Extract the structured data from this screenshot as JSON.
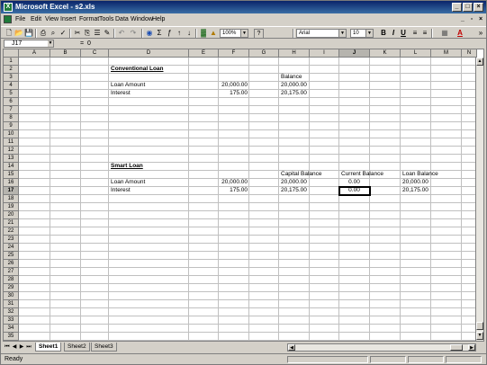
{
  "window": {
    "title": "Microsoft Excel - s2.xls",
    "app_icon_glyph": "X",
    "buttons": [
      "_",
      "□",
      "×"
    ]
  },
  "menu": {
    "items": [
      "File",
      "Edit",
      "View",
      "Insert",
      "Format",
      "Tools",
      "Data",
      "Window",
      "Help"
    ],
    "doc_buttons": [
      "_",
      "▫",
      "×"
    ]
  },
  "toolbar": {
    "zoom": "100%",
    "font": "Arial",
    "size": "10",
    "help": "?"
  },
  "formula_bar": {
    "name_box": "J17",
    "equals": "=",
    "value": "0"
  },
  "columns": [
    "A",
    "B",
    "C",
    "D",
    "E",
    "F",
    "G",
    "H",
    "I",
    "J",
    "K",
    "L",
    "M",
    "N"
  ],
  "active_column": "J",
  "active_row": "17",
  "rows": [
    "1",
    "2",
    "3",
    "4",
    "5",
    "6",
    "7",
    "8",
    "9",
    "10",
    "11",
    "12",
    "13",
    "14",
    "15",
    "16",
    "17",
    "18",
    "19",
    "20",
    "21",
    "22",
    "23",
    "24",
    "25",
    "26",
    "27",
    "28",
    "29",
    "30",
    "31",
    "32",
    "33",
    "34",
    "35",
    "36"
  ],
  "cells": {
    "d2": "Conventional Loan",
    "h3": "Balance",
    "d4": "Loan Amount",
    "f4": "20,000.00",
    "h4": "20,000.00",
    "d5": "Interest",
    "f5": "175.00",
    "h5": "20,175.00",
    "d14": "Smart Loan",
    "h15": "Capital Balance",
    "j15": "Current Balance",
    "l15": "Loan Balance",
    "d16": "Loan Amount",
    "f16": "20,000.00",
    "h16": "20,000.00",
    "j16": "0.00",
    "l16": "20,000.00",
    "d17": "Interest",
    "f17": "175.00",
    "h17": "20,175.00",
    "j17": "0.00",
    "l17": "20,175.00"
  },
  "sheet_tabs": [
    "Sheet1",
    "Sheet2",
    "Sheet3"
  ],
  "active_sheet": "Sheet1",
  "status": "Ready"
}
